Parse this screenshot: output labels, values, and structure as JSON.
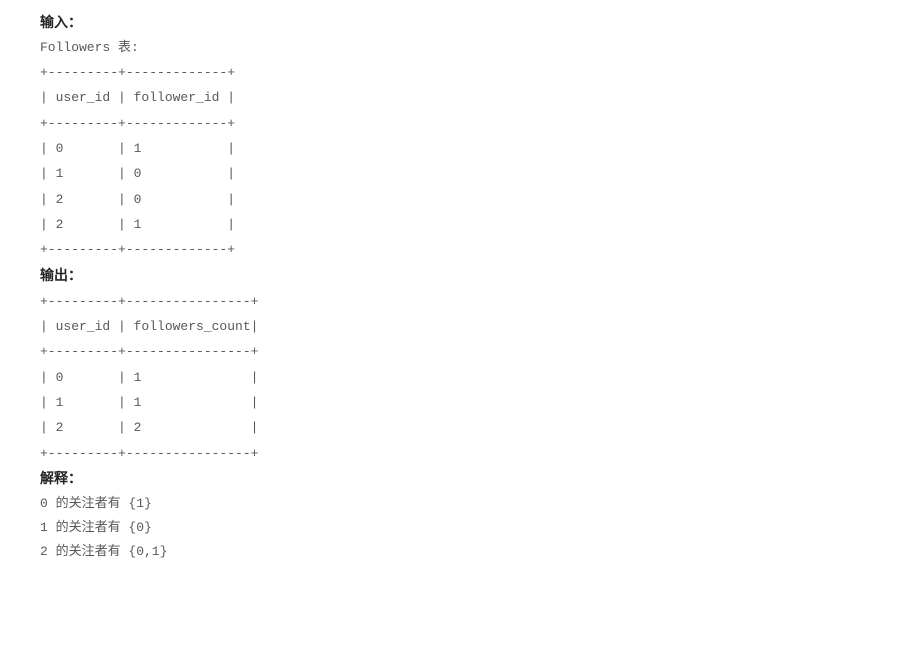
{
  "section_input": {
    "heading": "输入：",
    "table_label": "Followers 表:",
    "ascii_table": "+---------+-------------+\n| user_id | follower_id |\n+---------+-------------+\n| 0       | 1           |\n| 1       | 0           |\n| 2       | 0           |\n| 2       | 1           |\n+---------+-------------+"
  },
  "section_output": {
    "heading": "输出：",
    "ascii_table": "+---------+----------------+\n| user_id | followers_count|\n+---------+----------------+\n| 0       | 1              |\n| 1       | 1              |\n| 2       | 2              |\n+---------+----------------+"
  },
  "section_explanation": {
    "heading": "解释：",
    "lines": [
      "0 的关注者有 {1}",
      "1 的关注者有 {0}",
      "2 的关注者有 {0,1}"
    ]
  },
  "chart_data": {
    "type": "table",
    "tables": [
      {
        "name": "Followers",
        "columns": [
          "user_id",
          "follower_id"
        ],
        "rows": [
          [
            0,
            1
          ],
          [
            1,
            0
          ],
          [
            2,
            0
          ],
          [
            2,
            1
          ]
        ]
      },
      {
        "name": "Output",
        "columns": [
          "user_id",
          "followers_count"
        ],
        "rows": [
          [
            0,
            1
          ],
          [
            1,
            1
          ],
          [
            2,
            2
          ]
        ]
      }
    ]
  }
}
